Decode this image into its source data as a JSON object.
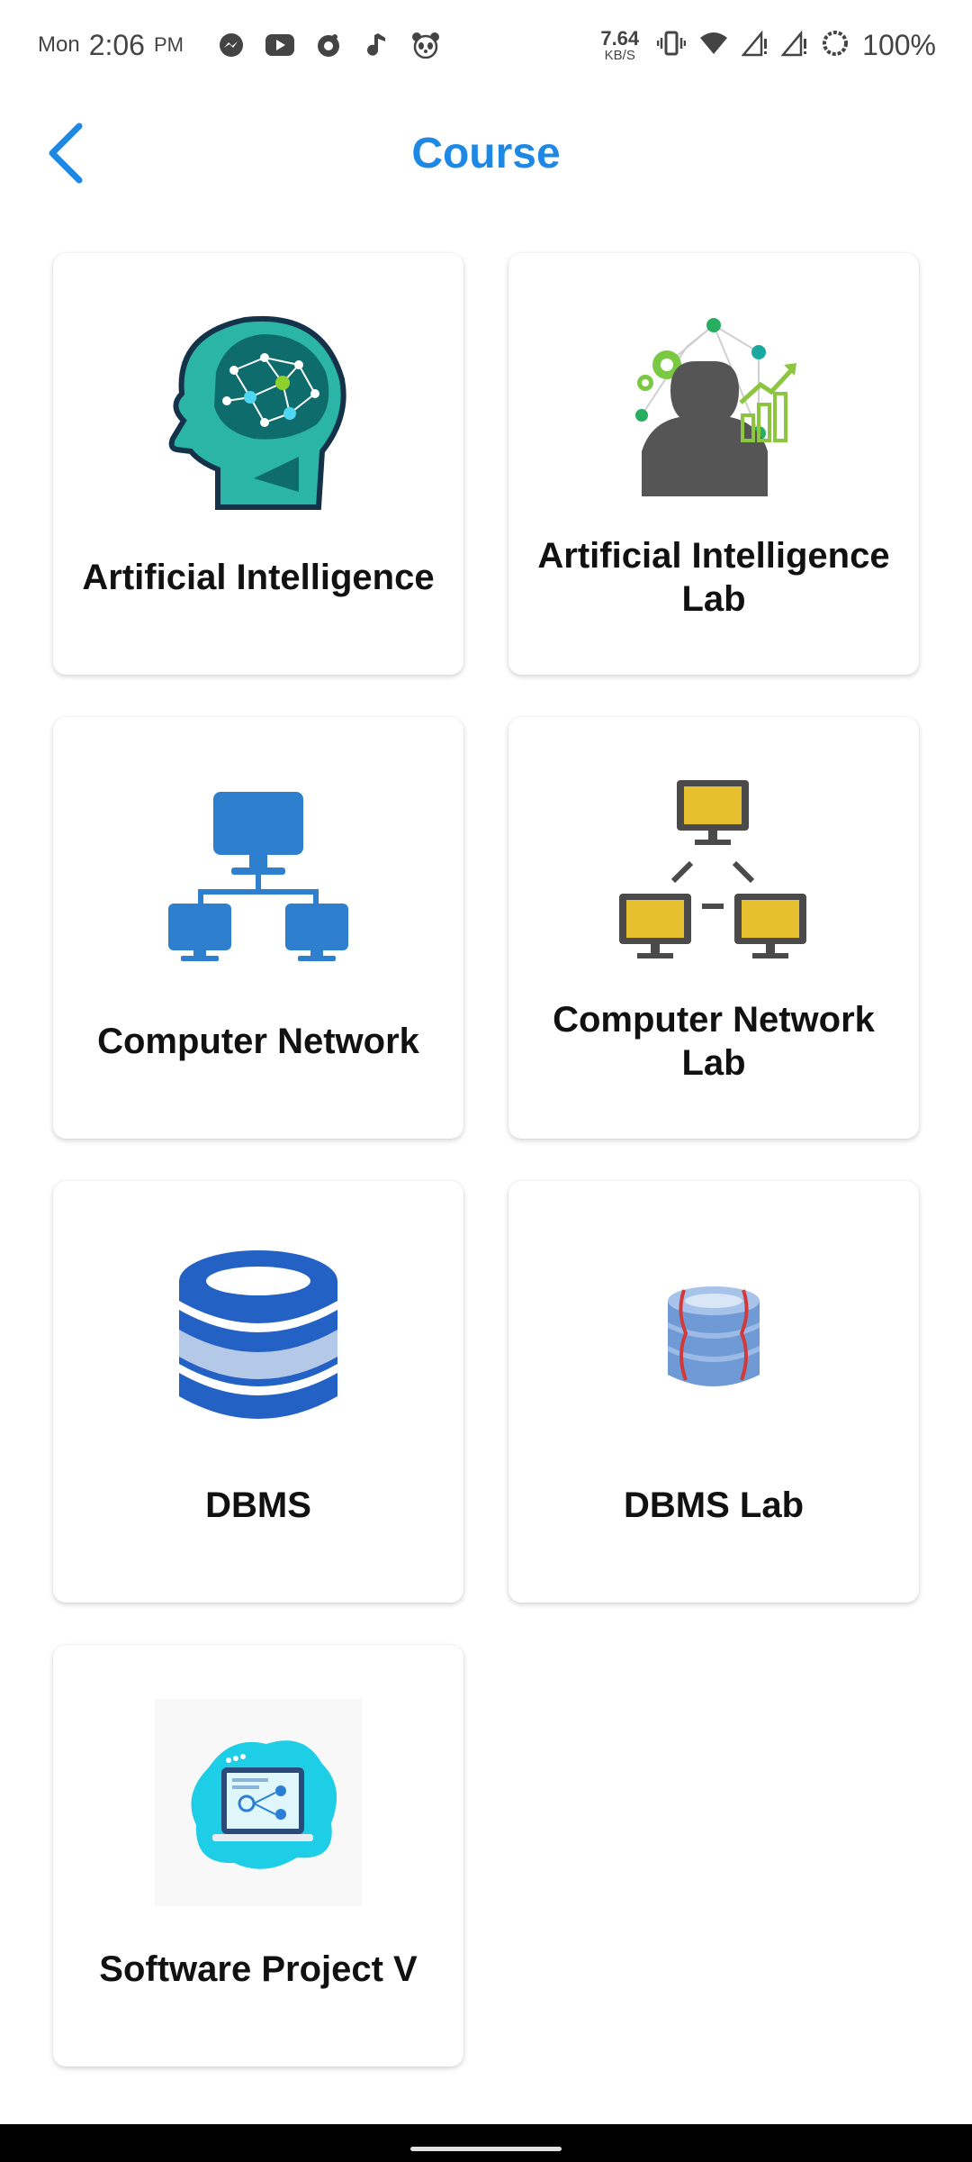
{
  "status_bar": {
    "day": "Mon",
    "time": "2:06",
    "ampm": "PM",
    "net_speed_value": "7.64",
    "net_speed_unit": "KB/S",
    "battery": "100%",
    "notification_icons": [
      "messenger-icon",
      "youtube-icon",
      "app-icon",
      "music-icon",
      "panda-icon"
    ]
  },
  "header": {
    "title": "Course",
    "back_icon": "chevron-left-icon",
    "accent_color": "#1e88e5"
  },
  "courses": [
    {
      "label": "Artificial Intelligence",
      "icon": "ai-brain-icon"
    },
    {
      "label": "Artificial Intelligence Lab",
      "icon": "ai-lab-person-icon"
    },
    {
      "label": "Computer Network",
      "icon": "network-diagram-icon"
    },
    {
      "label": "Computer Network Lab",
      "icon": "network-lab-icon"
    },
    {
      "label": "DBMS",
      "icon": "database-icon"
    },
    {
      "label": "DBMS Lab",
      "icon": "database-lab-icon"
    },
    {
      "label": "Software Project V",
      "icon": "software-project-laptop-icon"
    }
  ]
}
